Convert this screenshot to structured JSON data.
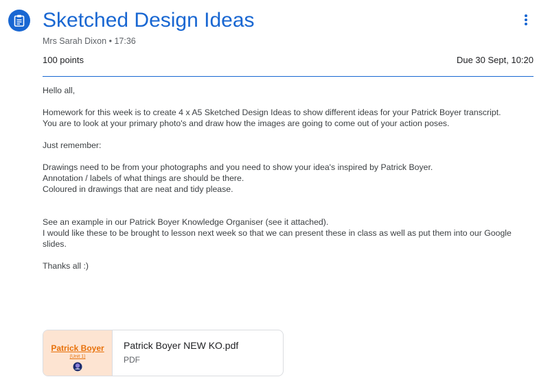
{
  "assignment": {
    "title": "Sketched Design Ideas",
    "author": "Mrs Sarah Dixon",
    "separator": "•",
    "time": "17:36",
    "points": "100 points",
    "due": "Due 30 Sept, 10:20",
    "icon": "assignment-icon",
    "accent_color": "#1967d2"
  },
  "menu": {
    "icon": "more-vert-icon"
  },
  "body": {
    "paragraphs": [
      [
        "Hello all,"
      ],
      [
        "Homework for this week is to create 4 x A5 Sketched Design Ideas to show different ideas for your Patrick Boyer transcript.",
        "You are to look at your primary photo's and draw how the images are going to come out of your action poses."
      ],
      [
        "Just remember:"
      ],
      [
        "Drawings need to be from your photographs and you need to show your idea's inspired by Patrick Boyer.",
        "Annotation / labels of what things are should be there.",
        "Coloured in drawings that are neat and tidy please."
      ],
      [
        "See an example in our Patrick Boyer Knowledge Organiser (see it attached).",
        "I would like these to be brought to lesson next week so that we can present these in class as well as put them into our Google slides."
      ],
      [
        "Thanks all :)"
      ]
    ]
  },
  "attachment": {
    "name": "Patrick Boyer NEW KO.pdf",
    "type": "PDF",
    "thumbnail_title": "Patrick Boyer",
    "thumbnail_subtitle": "(Unit 1)",
    "thumbnail_color": "#e8710a",
    "thumbnail_bg": "#fde4d2"
  }
}
